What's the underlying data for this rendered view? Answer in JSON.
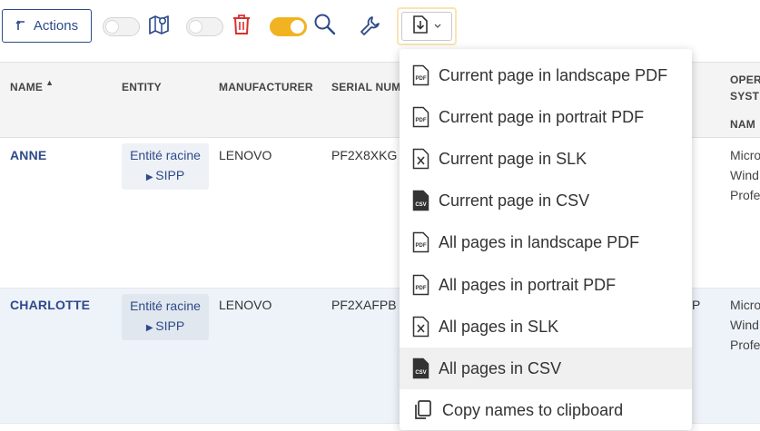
{
  "toolbar": {
    "actions_label": "Actions",
    "toggles": [
      {
        "name": "map-toggle",
        "state": "off"
      },
      {
        "name": "delete-toggle",
        "state": "off"
      },
      {
        "name": "search-toggle",
        "state": "on"
      }
    ],
    "icons": [
      "arrow-return-icon",
      "map-pin-icon",
      "trash-icon",
      "search-icon",
      "wrench-icon",
      "download-icon",
      "chevron-down-icon"
    ],
    "colors": {
      "accent": "#2d4a8a",
      "toggle_on": "#f2b322",
      "trash": "#d9302c"
    }
  },
  "table": {
    "columns": [
      "NAME",
      "ENTITY",
      "MANUFACTURER",
      "SERIAL NUM",
      "OPER",
      "SYST",
      "NAM"
    ],
    "rows": [
      {
        "name": "ANNE",
        "entity_line1": "Entité racine",
        "entity_line2": "SIPP",
        "manufacturer": "LENOVO",
        "serial": "PF2X8XKG",
        "extra": "",
        "os_line1": "Micro",
        "os_line2": "Wind",
        "os_line3": "Profe"
      },
      {
        "name": "CHARLOTTE",
        "entity_line1": "Entité racine",
        "entity_line2": "SIPP",
        "manufacturer": "LENOVO",
        "serial": "PF2XAFPB",
        "extra": "P",
        "os_line1": "Micro",
        "os_line2": "Wind",
        "os_line3": "Profe"
      }
    ]
  },
  "export_menu": {
    "items": [
      {
        "label": "Current page in landscape PDF",
        "icon": "pdf-file-icon"
      },
      {
        "label": "Current page in portrait PDF",
        "icon": "pdf-file-icon"
      },
      {
        "label": "Current page in SLK",
        "icon": "slk-file-icon"
      },
      {
        "label": "Current page in CSV",
        "icon": "csv-file-icon"
      },
      {
        "label": "All pages in landscape PDF",
        "icon": "pdf-file-icon"
      },
      {
        "label": "All pages in portrait PDF",
        "icon": "pdf-file-icon"
      },
      {
        "label": "All pages in SLK",
        "icon": "slk-file-icon"
      },
      {
        "label": "All pages in CSV",
        "icon": "csv-file-icon"
      },
      {
        "label": "Copy names to clipboard",
        "icon": "copy-icon"
      }
    ],
    "highlighted_label": "All pages in CSV"
  }
}
